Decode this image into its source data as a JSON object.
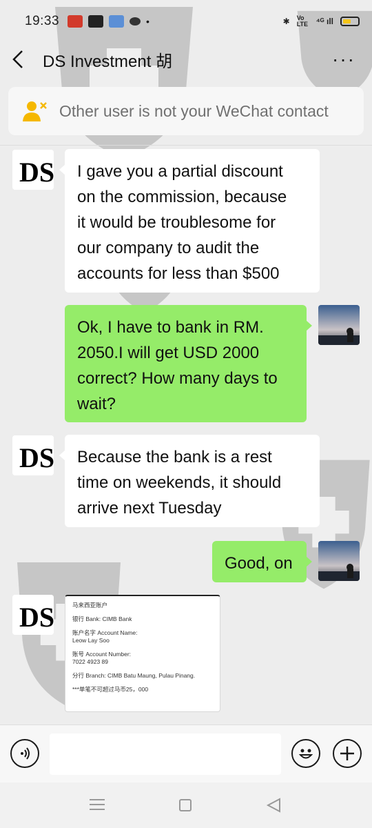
{
  "status_bar": {
    "time": "19:33",
    "app_icons": [
      "#d23a2b",
      "#222222",
      "#5b8fd6",
      "#333333"
    ],
    "indicators": [
      "✱",
      "Vo LTE",
      "⁴ᴳ ıll"
    ]
  },
  "header": {
    "title": "DS Investment 胡",
    "more_label": "···"
  },
  "notice": {
    "text": "Other user is not your WeChat contact"
  },
  "messages": [
    {
      "side": "left",
      "lines": [
        "I gave you a partial discount",
        "on the commission, because",
        "it would be troublesome for",
        "our company to audit the",
        "accounts for less than $500"
      ]
    },
    {
      "side": "right",
      "lines": [
        "Ok, I have to bank in RM.",
        "2050.I will get USD 2000",
        "correct? How many days to",
        "wait?"
      ]
    },
    {
      "side": "left",
      "lines": [
        "Because the bank is a rest",
        "time on weekends, it should",
        "arrive next Tuesday"
      ]
    },
    {
      "side": "right",
      "lines": [
        "Good, on"
      ]
    }
  ],
  "bank_image": {
    "lines": [
      "马来西亚账户",
      "银行 Bank: CIMB Bank",
      "账户名字 Account Name:",
      "Leow Lay Soo",
      "账号 Account Number:",
      "7022 4923 89",
      "分行 Branch: CIMB Batu Maung, Pulau Pinang.",
      "***单笔不可超过马币25，000"
    ]
  },
  "input_bar": {
    "value": ""
  },
  "colors": {
    "self_bubble": "#95ec69",
    "other_bubble": "#ffffff",
    "background": "#ededed"
  }
}
